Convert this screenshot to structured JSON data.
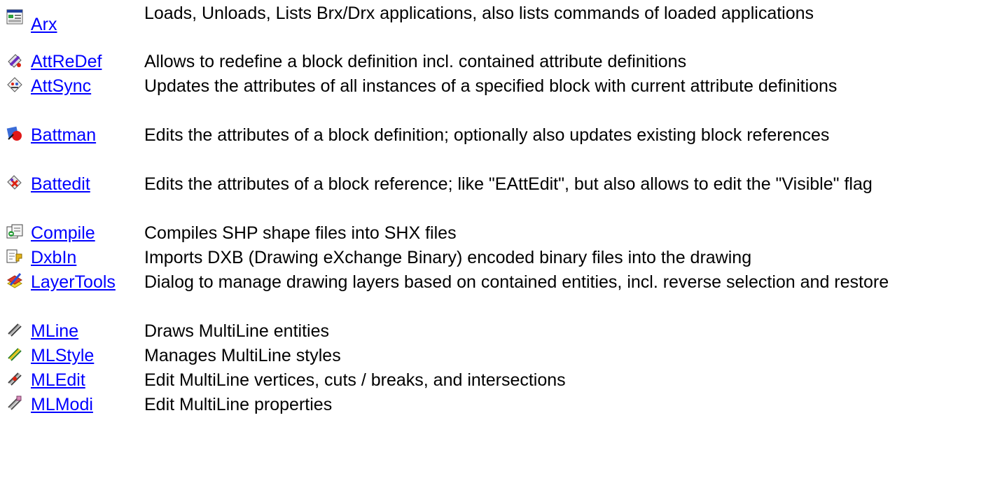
{
  "commands": [
    {
      "name": "Arx",
      "icon": "application-window-icon",
      "description": "Loads, Unloads, Lists Brx/Drx applications, also lists commands of loaded applications"
    },
    {
      "name": "AttReDef",
      "icon": "attribute-redefine-icon",
      "description": "Allows to redefine a block definition incl. contained attribute definitions"
    },
    {
      "name": "AttSync",
      "icon": "attribute-sync-icon",
      "description": "Updates the attributes of all instances of a specified block with current attribute definitions"
    },
    {
      "name": "Battman",
      "icon": "block-attribute-manager-icon",
      "description": "Edits the attributes of a block definition; optionally also updates existing block references"
    },
    {
      "name": "Battedit",
      "icon": "block-attribute-edit-icon",
      "description": "Edits the attributes of a block reference; like \"EAttEdit\", but also allows to edit the \"Visible\" flag"
    },
    {
      "name": "Compile",
      "icon": "compile-shape-icon",
      "description": "Compiles SHP shape files into SHX files"
    },
    {
      "name": "DxbIn",
      "icon": "import-dxb-icon",
      "description": "Imports DXB (Drawing eXchange Binary) encoded binary files into the drawing"
    },
    {
      "name": "LayerTools",
      "icon": "layer-tools-icon",
      "description": "Dialog to manage drawing layers based on contained entities, incl. reverse selection and restore"
    },
    {
      "name": "MLine",
      "icon": "multiline-draw-icon",
      "description": "Draws MultiLine entities"
    },
    {
      "name": "MLStyle",
      "icon": "multiline-style-icon",
      "description": "Manages MultiLine styles"
    },
    {
      "name": "MLEdit",
      "icon": "multiline-edit-icon",
      "description": "Edit MultiLine vertices, cuts / breaks, and intersections"
    },
    {
      "name": "MLModi",
      "icon": "multiline-modify-icon",
      "description": "Edit MultiLine properties"
    }
  ]
}
